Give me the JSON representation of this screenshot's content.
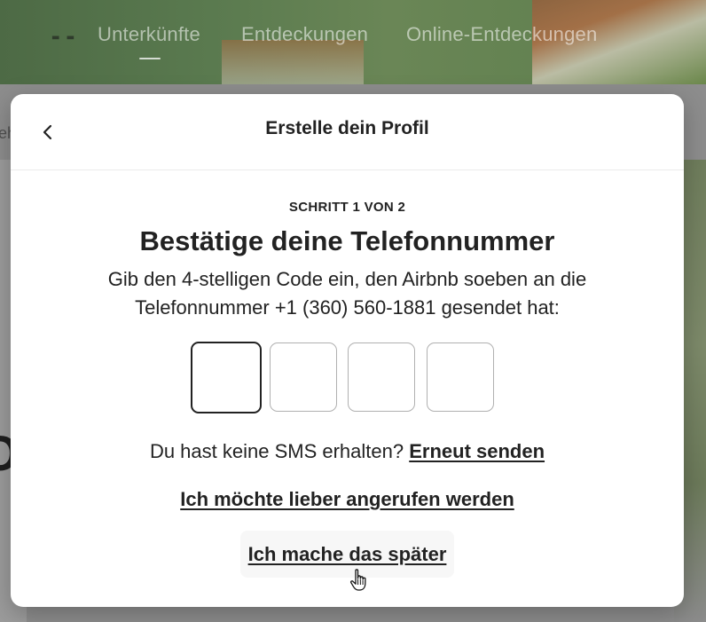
{
  "nav": {
    "items": [
      {
        "label": "Unterkünfte",
        "active": true
      },
      {
        "label": "Entdeckungen",
        "active": false
      },
      {
        "label": "Online-Entdeckungen",
        "active": false
      }
    ]
  },
  "modal": {
    "title": "Erstelle dein Profil",
    "step_label": "SCHRITT 1 VON 2",
    "heading": "Bestätige deine Telefonnummer",
    "description": "Gib den 4-stelligen Code ein, den Airbnb soeben an die Telefonnummer +1 (360) 560-1881 gesendet hat:",
    "code_inputs": [
      "",
      "",
      "",
      ""
    ],
    "resend_prompt": "Du hast keine SMS erhalten?",
    "resend_link": "Erneut senden",
    "call_link": "Ich möchte lieber angerufen werden",
    "later_button": "Ich mache das später"
  },
  "background": {
    "left_fragment": "eh",
    "big_letter": "O"
  },
  "icons": {
    "back": "chevron-left-icon",
    "cursor": "hand-pointer-icon"
  },
  "colors": {
    "text": "#222222",
    "border": "#b0b0b0",
    "active_border": "#222222",
    "button_bg": "#f7f7f7"
  }
}
